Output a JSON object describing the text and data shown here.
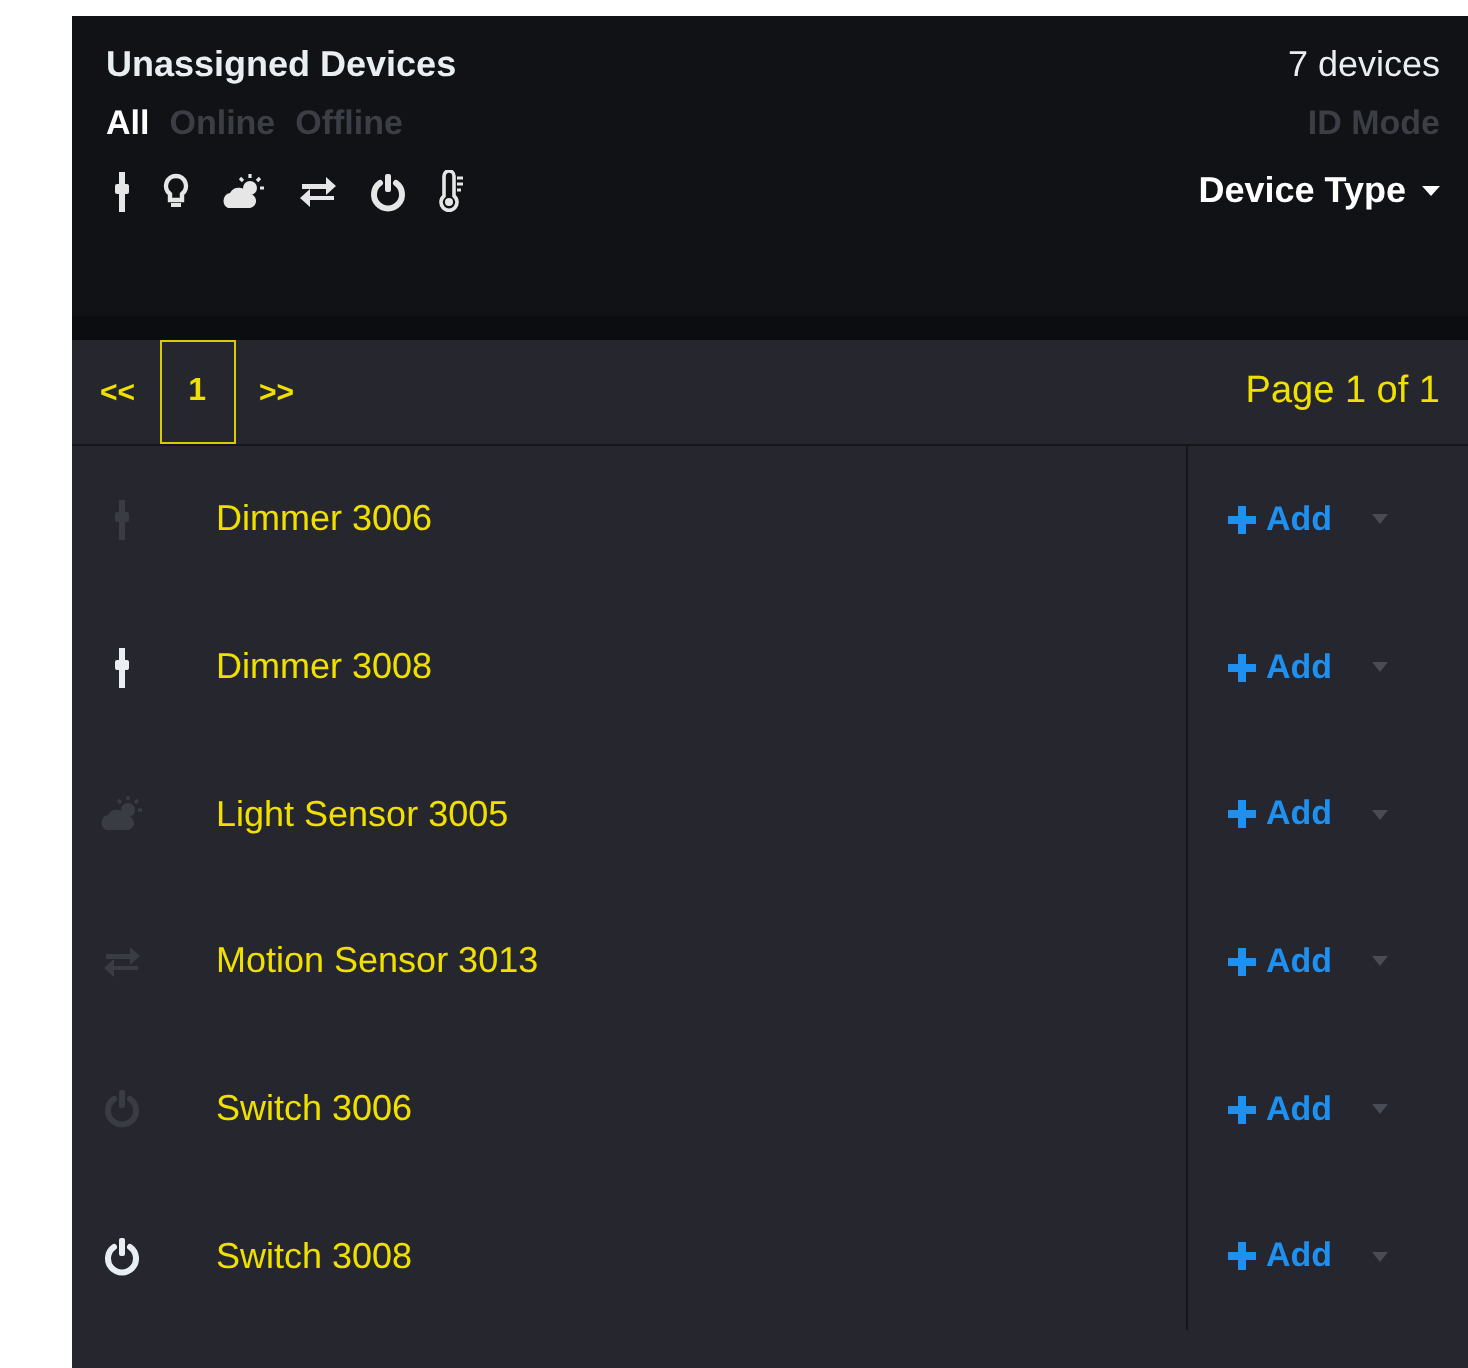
{
  "header": {
    "title": "Unassigned Devices",
    "count": "7 devices",
    "id_mode": {
      "label": "ID Mode",
      "disabled": true
    },
    "filters": [
      {
        "label": "All",
        "selected": true
      },
      {
        "label": "Online",
        "selected": false
      },
      {
        "label": "Offline",
        "selected": false
      }
    ],
    "type_icons": [
      {
        "kind": "dimmer"
      },
      {
        "kind": "bulb"
      },
      {
        "kind": "weather"
      },
      {
        "kind": "arrows"
      },
      {
        "kind": "power"
      },
      {
        "kind": "thermometer"
      }
    ],
    "device_type": {
      "label": "Device Type"
    }
  },
  "pager": {
    "prev": "<<",
    "pages": [
      {
        "label": "1",
        "selected": true
      }
    ],
    "next": ">>",
    "summary": "Page 1 of 1"
  },
  "devices": [
    {
      "name": "Dimmer 3006",
      "kind": "dimmer",
      "online": false,
      "action": "Add"
    },
    {
      "name": "Dimmer 3008",
      "kind": "dimmer",
      "online": true,
      "action": "Add"
    },
    {
      "name": "Light Sensor 3005",
      "kind": "weather",
      "online": false,
      "action": "Add"
    },
    {
      "name": "Motion Sensor 3013",
      "kind": "arrows",
      "online": false,
      "action": "Add"
    },
    {
      "name": "Switch 3006",
      "kind": "power",
      "online": false,
      "action": "Add"
    },
    {
      "name": "Switch 3008",
      "kind": "power",
      "online": true,
      "action": "Add"
    }
  ]
}
